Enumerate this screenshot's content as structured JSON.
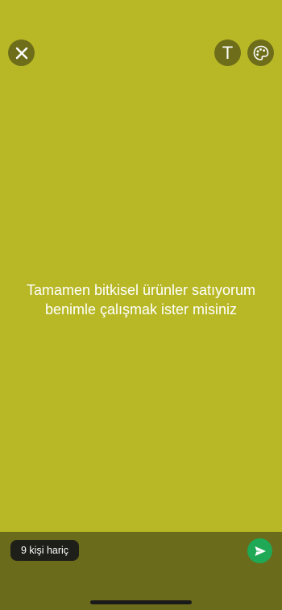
{
  "colors": {
    "background": "#b8b826",
    "button_background": "#6e6e1a",
    "bottom_bar": "#6b6b1c",
    "send_button": "#1fa855",
    "text": "#ffffff"
  },
  "toolbar": {
    "close_icon": "close-icon",
    "text_tool_label": "T",
    "palette_icon": "palette-icon"
  },
  "status": {
    "text": "Tamamen bitkisel ürünler satıyorum benimle çalışmak ister misiniz"
  },
  "footer": {
    "privacy_label": "9 kişi hariç",
    "send_icon": "send-icon"
  }
}
